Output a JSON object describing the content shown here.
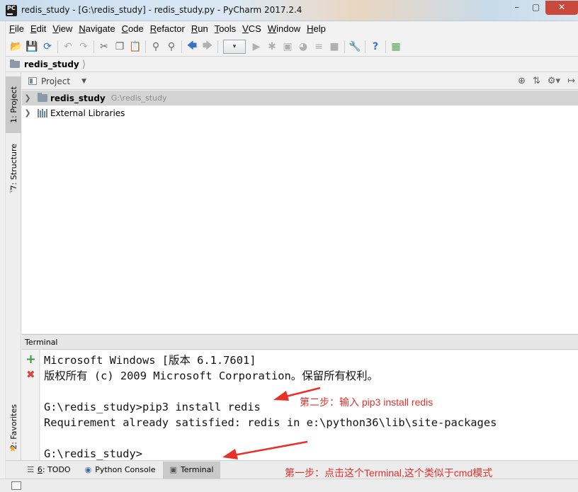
{
  "window": {
    "title": "redis_study - [G:\\redis_study] - redis_study.py - PyCharm 2017.2.4",
    "app_icon_text": "PC",
    "controls": {
      "minimize": "–",
      "maximize": "▢",
      "close": "✕"
    }
  },
  "menubar": {
    "items": [
      {
        "mn": "F",
        "rest": "ile"
      },
      {
        "mn": "E",
        "rest": "dit"
      },
      {
        "mn": "V",
        "rest": "iew"
      },
      {
        "mn": "N",
        "rest": "avigate"
      },
      {
        "mn": "C",
        "rest": "ode"
      },
      {
        "mn": "R",
        "rest": "efactor"
      },
      {
        "mn": "R",
        "rest": "un"
      },
      {
        "mn": "T",
        "rest": "ools"
      },
      {
        "mn": "V",
        "rest": "CS"
      },
      {
        "mn": "W",
        "rest": "indow"
      },
      {
        "mn": "H",
        "rest": "elp"
      }
    ]
  },
  "toolbar": {
    "icons": [
      "open-folder-icon",
      "save-icon",
      "sync-icon",
      "undo-icon",
      "redo-icon",
      "cut-icon",
      "copy-icon",
      "paste-icon",
      "find-icon",
      "replace-icon",
      "back-icon",
      "forward-icon",
      "run-config-combo",
      "run-icon",
      "debug-icon",
      "coverage-icon",
      "profile-icon",
      "concurrency-icon",
      "stop-icon",
      "project-structure-icon",
      "help-icon",
      "sdk-icon"
    ],
    "combo_arrow": "▾"
  },
  "navbar": {
    "crumb": "redis_study"
  },
  "left_stripe": {
    "project_tab": "1: Project",
    "structure_tab": "7: Structure",
    "favorites_tab": "2: Favorites"
  },
  "project_panel": {
    "title": "Project",
    "tree": [
      {
        "name": "redis_study",
        "path": "G:\\redis_study"
      },
      {
        "name": "External Libraries"
      }
    ]
  },
  "terminal": {
    "header": "Terminal",
    "lines": [
      "Microsoft Windows [版本 6.1.7601]",
      "版权所有 (c) 2009 Microsoft Corporation。保留所有权利。",
      "",
      "G:\\redis_study>pip3 install redis",
      "Requirement already satisfied: redis in e:\\python36\\lib\\site-packages",
      "",
      "G:\\redis_study>"
    ]
  },
  "annotations": {
    "step2": "第二步：输入 pip3 install redis",
    "step1": "第一步：点击这个Terminal,这个类似于cmd模式",
    "color": "#e8302a"
  },
  "bottom_tabs": {
    "todo": {
      "mn": "6",
      "rest": ": TODO"
    },
    "python_console": "Python Console",
    "terminal": "Terminal"
  }
}
